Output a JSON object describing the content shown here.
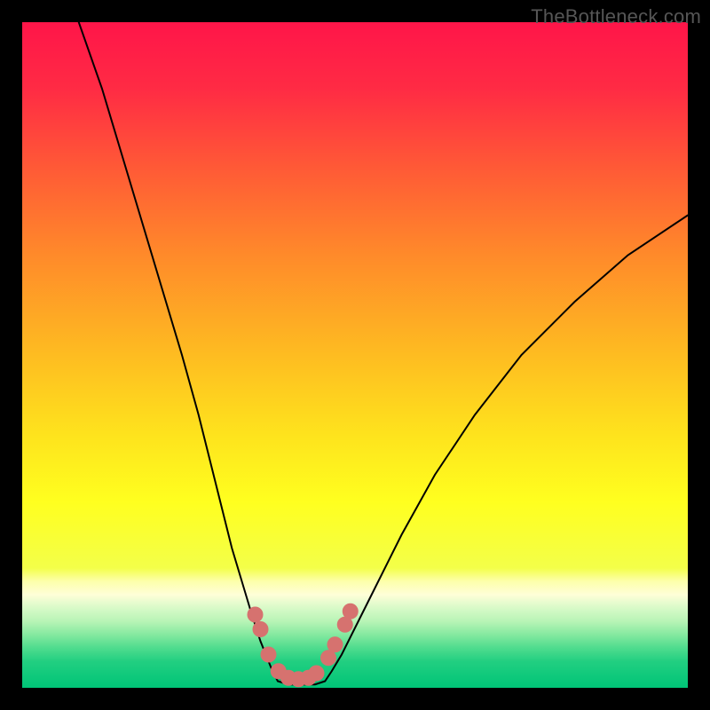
{
  "watermark": "TheBottleneck.com",
  "colors": {
    "frame_bg": "#000000",
    "marker_fill": "#d6726f",
    "curve_stroke": "#000000"
  },
  "chart_data": {
    "type": "line",
    "title": "",
    "xlabel": "",
    "ylabel": "",
    "xlim": [
      0,
      100
    ],
    "ylim": [
      0,
      100
    ],
    "gradient_stops": [
      {
        "pos": 0,
        "color": "#ff1549"
      },
      {
        "pos": 10,
        "color": "#ff2b44"
      },
      {
        "pos": 22,
        "color": "#ff5a36"
      },
      {
        "pos": 35,
        "color": "#ff8a2a"
      },
      {
        "pos": 50,
        "color": "#febc21"
      },
      {
        "pos": 62,
        "color": "#fee31d"
      },
      {
        "pos": 72,
        "color": "#ffff1f"
      },
      {
        "pos": 82,
        "color": "#f3ff49"
      },
      {
        "pos": 84,
        "color": "#fdffab"
      },
      {
        "pos": 86,
        "color": "#fefed8"
      },
      {
        "pos": 88,
        "color": "#d8fac8"
      },
      {
        "pos": 90,
        "color": "#b8f4b6"
      },
      {
        "pos": 92,
        "color": "#85e9a0"
      },
      {
        "pos": 94,
        "color": "#4fdc8e"
      },
      {
        "pos": 96,
        "color": "#22cf81"
      },
      {
        "pos": 100,
        "color": "#00c477"
      }
    ],
    "series": [
      {
        "name": "left-curve",
        "x": [
          8.5,
          12,
          15,
          18,
          21,
          24,
          26.5,
          28.5,
          30,
          31.5,
          33,
          34.5,
          35.8,
          36.8,
          37.6,
          38.4
        ],
        "y": [
          100,
          90,
          80,
          70,
          60,
          50,
          41,
          33,
          27,
          21,
          16,
          11,
          7,
          4.5,
          2.5,
          1
        ]
      },
      {
        "name": "right-curve",
        "x": [
          45.5,
          46.5,
          48,
          50,
          53,
          57,
          62,
          68,
          75,
          83,
          91,
          100
        ],
        "y": [
          1,
          2.5,
          5,
          9,
          15,
          23,
          32,
          41,
          50,
          58,
          65,
          71
        ]
      },
      {
        "name": "valley-floor",
        "x": [
          38.4,
          40,
          42,
          44,
          45.5
        ],
        "y": [
          1,
          0.5,
          0.5,
          0.5,
          1
        ]
      }
    ],
    "markers": [
      {
        "x": 35.0,
        "y": 11.0
      },
      {
        "x": 35.8,
        "y": 8.8
      },
      {
        "x": 37.0,
        "y": 5.0
      },
      {
        "x": 38.5,
        "y": 2.5
      },
      {
        "x": 40.0,
        "y": 1.5
      },
      {
        "x": 41.5,
        "y": 1.3
      },
      {
        "x": 43.0,
        "y": 1.5
      },
      {
        "x": 44.2,
        "y": 2.2
      },
      {
        "x": 46.0,
        "y": 4.5
      },
      {
        "x": 47.0,
        "y": 6.5
      },
      {
        "x": 48.5,
        "y": 9.5
      },
      {
        "x": 49.3,
        "y": 11.5
      }
    ],
    "marker_radius_px": 9
  }
}
